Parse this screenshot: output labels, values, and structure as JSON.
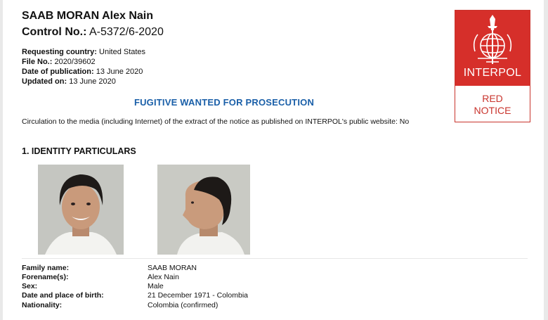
{
  "header": {
    "name": "SAAB MORAN Alex Nain",
    "control_label": "Control No.:",
    "control_value": "A-5372/6-2020"
  },
  "meta": [
    {
      "label": "Requesting country:",
      "value": "United States"
    },
    {
      "label": "File No.:",
      "value": "2020/39602"
    },
    {
      "label": "Date of publication:",
      "value": "13 June 2020"
    },
    {
      "label": "Updated on:",
      "value": "13 June 2020"
    }
  ],
  "notice_type": "FUGITIVE WANTED FOR PROSECUTION",
  "circulation": "Circulation to the media (including Internet) of the extract of the notice as published on INTERPOL's public website: No",
  "section_title": "1. IDENTITY PARTICULARS",
  "badge": {
    "org": "INTERPOL",
    "line1": "RED",
    "line2": "NOTICE",
    "color": "#d62f2a"
  },
  "particulars": [
    {
      "label": "Family name:",
      "value": "SAAB MORAN"
    },
    {
      "label": "Forename(s):",
      "value": "Alex Nain"
    },
    {
      "label": "Sex:",
      "value": "Male"
    },
    {
      "label": "Date and place of birth:",
      "value": "21 December 1971 - Colombia"
    },
    {
      "label": "Nationality:",
      "value": "Colombia (confirmed)"
    }
  ]
}
